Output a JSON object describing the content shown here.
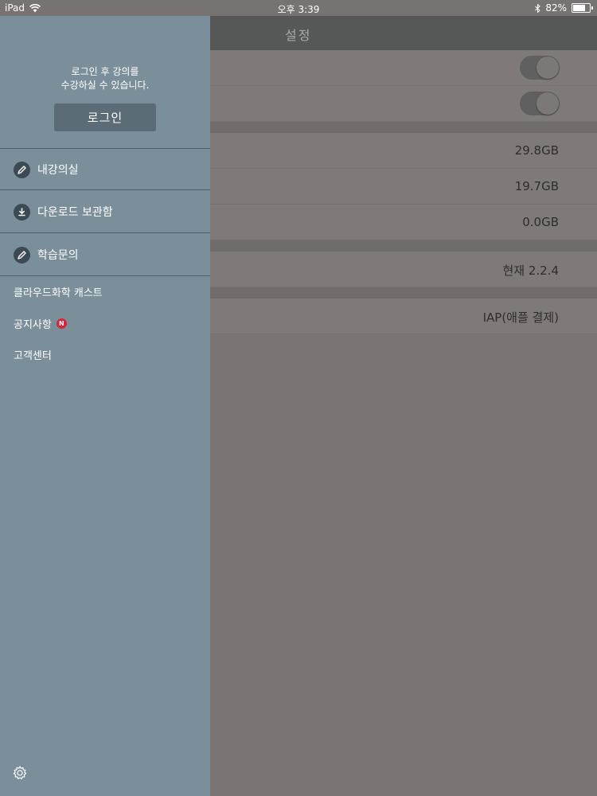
{
  "status_bar": {
    "device": "iPad",
    "time": "오후 3:39",
    "battery": "82%",
    "battery_level": 0.82
  },
  "drawer": {
    "login_message_line1": "로그인 후 강의를",
    "login_message_line2": "수강하실 수 있습니다.",
    "login_button": "로그인",
    "menu": [
      {
        "label": "내강의실",
        "icon": "pencil-icon"
      },
      {
        "label": "다운로드 보관함",
        "icon": "download-icon"
      },
      {
        "label": "학습문의",
        "icon": "pencil-icon"
      }
    ],
    "sub_items": [
      {
        "label": "클라우드화학 캐스트"
      },
      {
        "label": "공지사항",
        "badge": "N"
      },
      {
        "label": "고객센터"
      }
    ],
    "settings_icon": "gear-icon"
  },
  "main": {
    "title": "설정",
    "toggles": [
      {
        "on": true
      },
      {
        "on": true
      }
    ],
    "storage": [
      "29.8GB",
      "19.7GB",
      "0.0GB"
    ],
    "version": "현재 2.2.4",
    "payment": "IAP(애플 결제)"
  }
}
